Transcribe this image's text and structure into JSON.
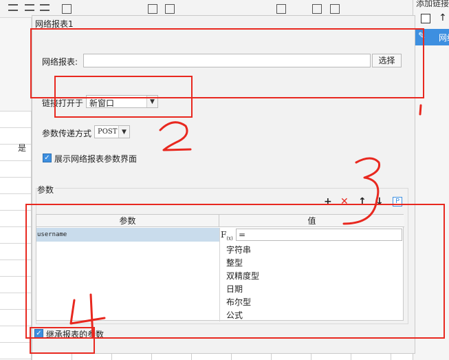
{
  "dialog": {
    "title": "网络报表1",
    "url_label": "网络报表:",
    "url_value": "",
    "select_button": "选择",
    "open_in_label": "链接打开于",
    "open_in_value": "新窗口",
    "method_label": "参数传递方式",
    "method_value": "POST",
    "show_params_label": "展示网络报表参数界面",
    "show_params_checked": true,
    "params_group_label": "参数",
    "inherit_label": "继承报表的参数",
    "inherit_checked": true
  },
  "params_table": {
    "headers": [
      "参数",
      "值"
    ],
    "rows": [
      {
        "name": "username",
        "value": "="
      }
    ],
    "type_options": [
      "字符串",
      "整型",
      "双精度型",
      "日期",
      "布尔型",
      "公式"
    ]
  },
  "toolbar_icons": [
    "add-icon",
    "delete-icon",
    "move-up-icon",
    "move-down-icon",
    "parameter-icon"
  ],
  "right_panel": {
    "title": "添加链接",
    "selected_item": "网络"
  },
  "background": {
    "grid_char": "是"
  },
  "colors": {
    "accent": "#3d8fe0",
    "annotation_red": "#e8281f",
    "selected_row": "#c9dcec"
  }
}
